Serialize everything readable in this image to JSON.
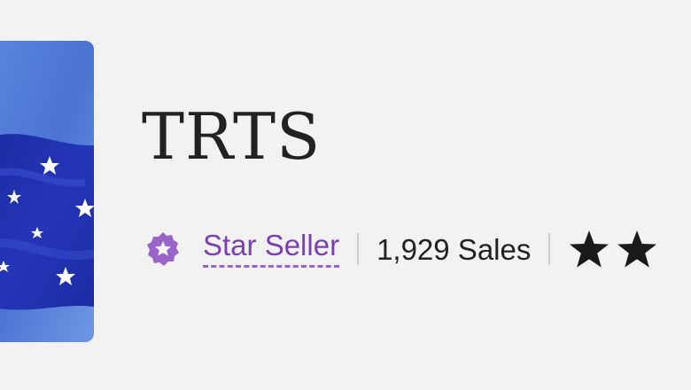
{
  "shop": {
    "name": "TRTS",
    "badge_label": "Star Seller",
    "sales_text": "1,929 Sales",
    "logo_icon": "flag-banner-icon",
    "badge_icon": "star-seller-badge-icon",
    "rating_icon": "rating-star-icon"
  },
  "colors": {
    "accent_purple": "#7c3fb1",
    "badge_purple": "#9a64c9",
    "text_dark": "#222222",
    "logo_blue": "#3f63c6"
  }
}
